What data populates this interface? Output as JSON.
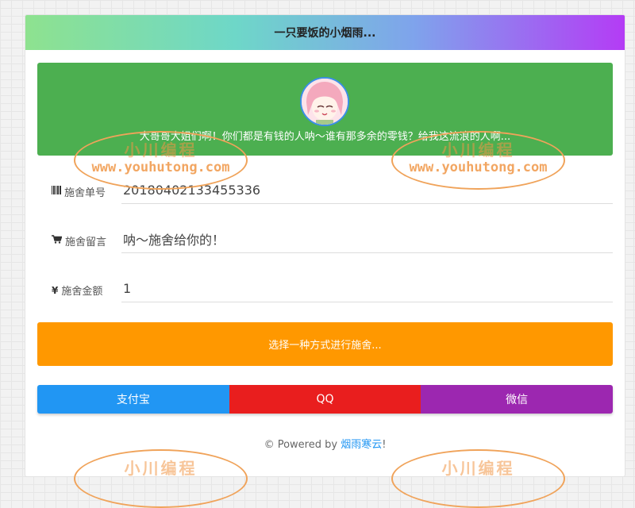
{
  "header": {
    "title": "一只要饭的小烟雨..."
  },
  "banner": {
    "text": "大哥哥大姐们啊！你们都是有钱的人呐～谁有那多余的零钱？给我这流浪的人啊..."
  },
  "form": {
    "order_label": "施舍单号",
    "order_value": "20180402133455336",
    "message_label": "施舍留言",
    "message_value": "呐～施舍给你的！",
    "amount_label": "施舍金额",
    "amount_value": "1"
  },
  "choose_label": "选择一种方式进行施舍...",
  "payment": {
    "alipay": "支付宝",
    "qq": "QQ",
    "wechat": "微信"
  },
  "footer": {
    "prefix": "© Powered by",
    "link": "烟雨寒云",
    "suffix": "!"
  },
  "watermark": {
    "text1": "小川编程",
    "text2": "www.youhutong.com"
  },
  "colors": {
    "banner_green": "#4caf50",
    "choose_orange": "#ff9800",
    "alipay_blue": "#2196f3",
    "qq_red": "#e91e1e",
    "wechat_purple": "#9c27b0"
  }
}
